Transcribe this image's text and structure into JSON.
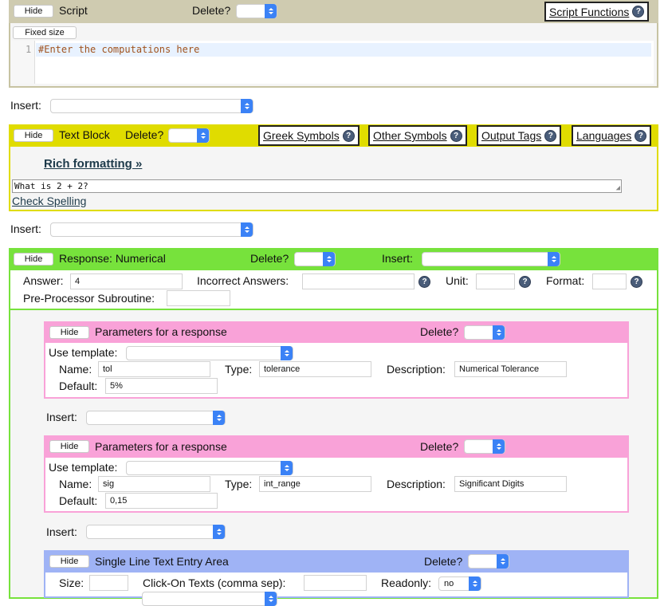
{
  "script": {
    "hide": "Hide",
    "title": "Script",
    "delete_label": "Delete?",
    "functions_link": "Script Functions",
    "fixed_size": "Fixed size",
    "line_no": "1",
    "code": "#Enter the computations here"
  },
  "insert_label": "Insert:",
  "text_block": {
    "hide": "Hide",
    "title": "Text Block",
    "delete_label": "Delete?",
    "greek": "Greek Symbols",
    "other": "Other Symbols",
    "output": "Output Tags",
    "languages": "Languages",
    "rich": "Rich formatting »",
    "content": "What is 2 + 2?",
    "spell": "Check Spelling"
  },
  "response": {
    "hide": "Hide",
    "title": "Response: Numerical",
    "delete_label": "Delete?",
    "insert_label": "Insert:",
    "answer_label": "Answer:",
    "answer_value": "4",
    "incorrect_label": "Incorrect Answers:",
    "unit_label": "Unit:",
    "format_label": "Format:",
    "preproc_label": "Pre-Processor Subroutine:"
  },
  "params": [
    {
      "hide": "Hide",
      "title": "Parameters for a response",
      "delete_label": "Delete?",
      "template_label": "Use template:",
      "name_label": "Name:",
      "name_value": "tol",
      "type_label": "Type:",
      "type_value": "tolerance",
      "desc_label": "Description:",
      "desc_value": "Numerical Tolerance",
      "default_label": "Default:",
      "default_value": "5%"
    },
    {
      "hide": "Hide",
      "title": "Parameters for a response",
      "delete_label": "Delete?",
      "template_label": "Use template:",
      "name_label": "Name:",
      "name_value": "sig",
      "type_label": "Type:",
      "type_value": "int_range",
      "desc_label": "Description:",
      "desc_value": "Significant Digits",
      "default_label": "Default:",
      "default_value": "0,15"
    }
  ],
  "text_entry": {
    "hide": "Hide",
    "title": "Single Line Text Entry Area",
    "delete_label": "Delete?",
    "size_label": "Size:",
    "clickon_label": "Click-On Texts (comma sep):",
    "readonly_label": "Readonly:",
    "readonly_value": "no"
  },
  "colors": {
    "script_header": "#cfcbb0",
    "script_border": "#c7c3a2",
    "text_block": "#e0dc00",
    "response": "#77e23c",
    "params": "#f9a2d8",
    "text_entry": "#9fb3f5",
    "panel_bg": "#f5f5f5"
  }
}
